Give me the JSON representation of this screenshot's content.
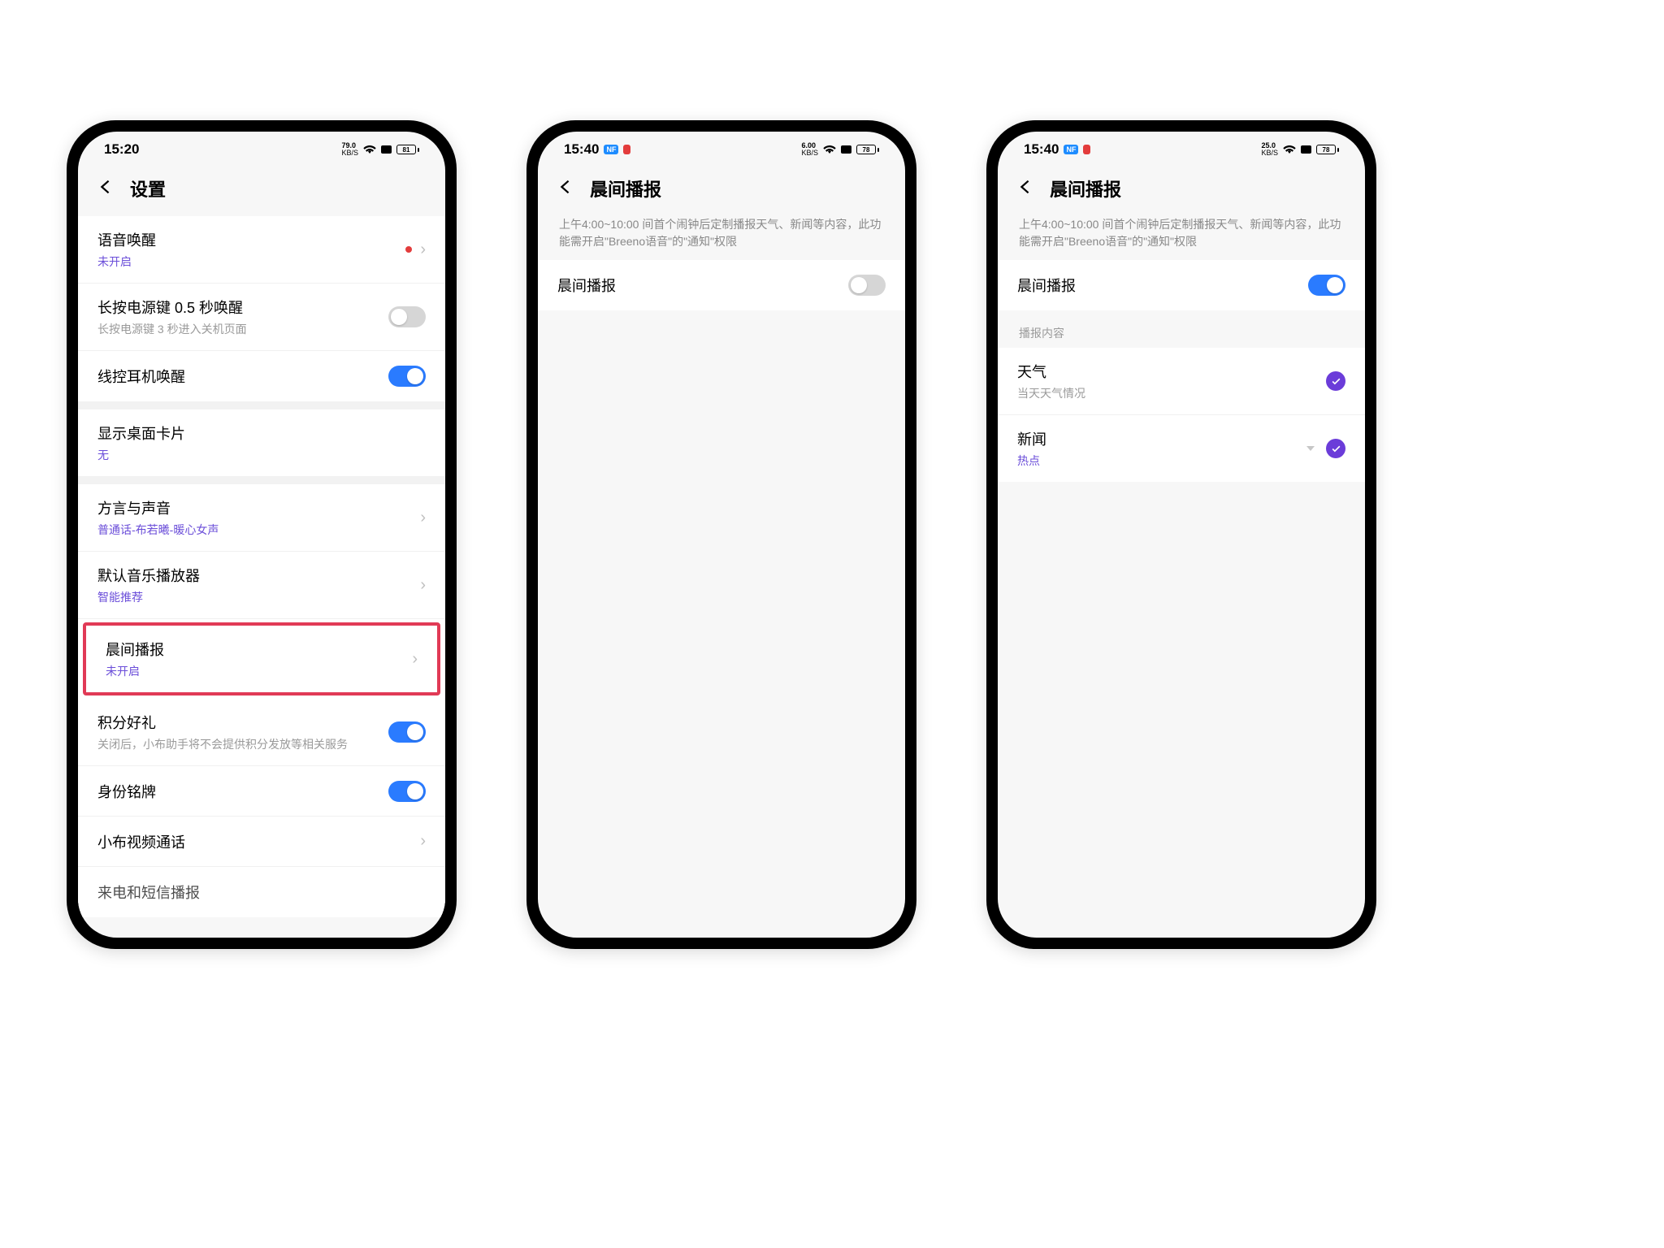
{
  "phone1": {
    "status": {
      "time": "15:20",
      "kbs_top": "79.0",
      "kbs_bot": "KB/S",
      "batt": "81"
    },
    "header": {
      "title": "设置"
    },
    "rows": {
      "voice_wake": {
        "title": "语音唤醒",
        "sub": "未开启"
      },
      "power_wake": {
        "title": "长按电源键 0.5 秒唤醒",
        "sub": "长按电源键 3 秒进入关机页面"
      },
      "wired_wake": {
        "title": "线控耳机唤醒"
      },
      "desktop_card": {
        "title": "显示桌面卡片",
        "sub": "无"
      },
      "dialect": {
        "title": "方言与声音",
        "sub": "普通话-布若曦-暖心女声"
      },
      "player": {
        "title": "默认音乐播放器",
        "sub": "智能推荐"
      },
      "morning": {
        "title": "晨间播报",
        "sub": "未开启"
      },
      "points": {
        "title": "积分好礼",
        "sub": "关闭后，小布助手将不会提供积分发放等相关服务"
      },
      "badge": {
        "title": "身份铭牌"
      },
      "video": {
        "title": "小布视频通话"
      },
      "cutoff": {
        "title": "来电和短信播报"
      }
    }
  },
  "phone2": {
    "status": {
      "time": "15:40",
      "kbs_top": "6.00",
      "kbs_bot": "KB/S",
      "batt": "78"
    },
    "header": {
      "title": "晨间播报"
    },
    "desc": "上午4:00~10:00 间首个闹钟后定制播报天气、新闻等内容，此功能需开启\"Breeno语音\"的\"通知\"权限",
    "rows": {
      "morning": {
        "title": "晨间播报"
      }
    }
  },
  "phone3": {
    "status": {
      "time": "15:40",
      "kbs_top": "25.0",
      "kbs_bot": "KB/S",
      "batt": "78"
    },
    "header": {
      "title": "晨间播报"
    },
    "desc": "上午4:00~10:00 间首个闹钟后定制播报天气、新闻等内容，此功能需开启\"Breeno语音\"的\"通知\"权限",
    "section_label": "播报内容",
    "rows": {
      "morning": {
        "title": "晨间播报"
      },
      "weather": {
        "title": "天气",
        "sub": "当天天气情况"
      },
      "news": {
        "title": "新闻",
        "sub": "热点"
      }
    }
  }
}
